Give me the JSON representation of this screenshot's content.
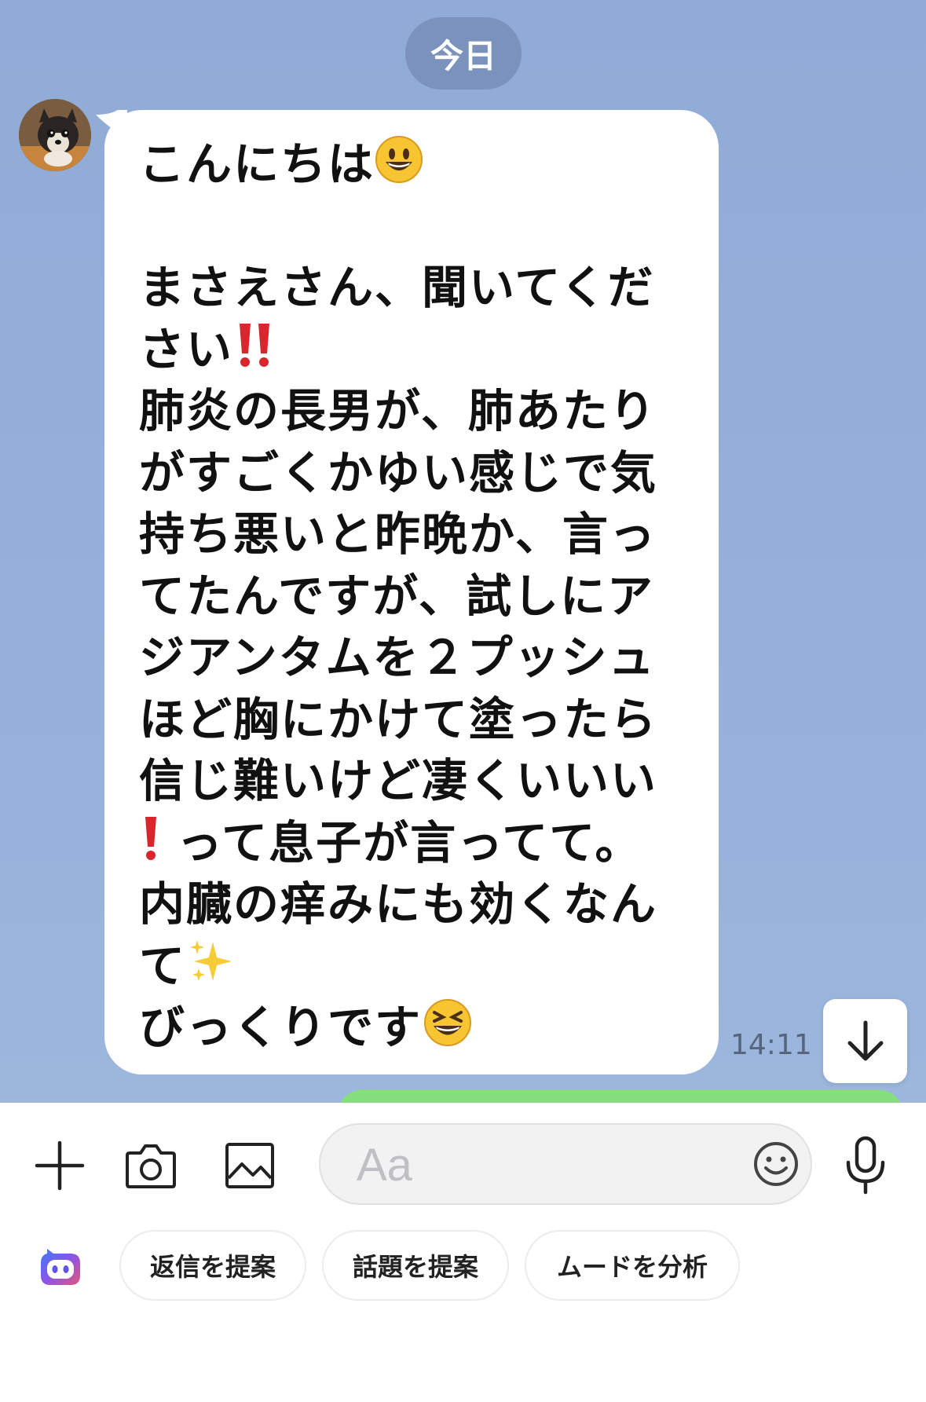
{
  "chat": {
    "date_label": "今日",
    "message": {
      "lines": [
        {
          "text": "こんにちは",
          "emoji": "grinning-face"
        },
        {
          "text": ""
        },
        {
          "text": "まさえさん、聞いてくだ"
        },
        {
          "text": "さい",
          "emoji": "double-exclamation"
        },
        {
          "text": "肺炎の長男が、肺あたり"
        },
        {
          "text": "がすごくかゆい感じで気"
        },
        {
          "text": "持ち悪いと昨晩か、言っ"
        },
        {
          "text": "てたんですが、試しにア"
        },
        {
          "text": "ジアンタムを２プッシュ"
        },
        {
          "text": "ほど胸にかけて塗ったら"
        },
        {
          "text": "信じ難いけど凄くいいい"
        },
        {
          "text": "って息子が言ってて。",
          "emoji_before": "exclamation"
        },
        {
          "text": "内臓の痒みにも効くなん"
        },
        {
          "text": "て",
          "emoji": "sparkles"
        },
        {
          "text": "びっくりです",
          "emoji": "laughing-face"
        }
      ],
      "time": "14:11"
    },
    "scroll_down_icon": "arrow-down-icon"
  },
  "composer": {
    "placeholder": "Aa",
    "icons": [
      "plus-icon",
      "camera-icon",
      "image-icon",
      "emoji-icon",
      "microphone-icon"
    ]
  },
  "suggestions": {
    "ai_icon": "ai-assistant-icon",
    "chips": [
      "返信を提案",
      "話題を提案",
      "ムードを分析"
    ]
  },
  "colors": {
    "chat_background": "#93add9",
    "bubble": "#ffffff",
    "date_pill": "#7b93bc",
    "outgoing_bubble": "#86df7d",
    "exclamation_red": "#d8262c"
  }
}
